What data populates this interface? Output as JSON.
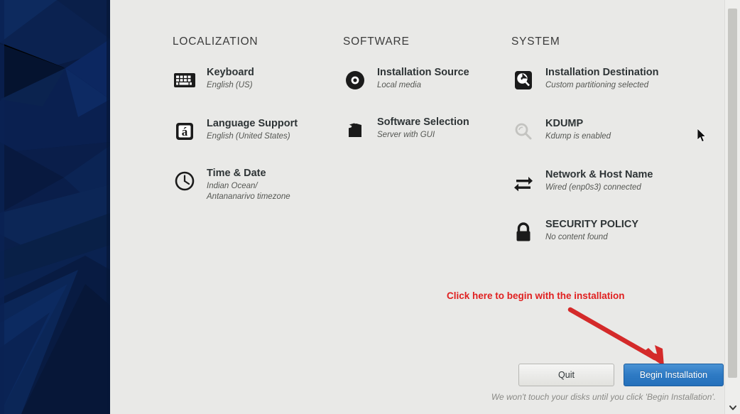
{
  "window": {
    "background_color": "#e9e9e7",
    "sidebar_color": "#0a1c44"
  },
  "columns": [
    {
      "id": "localization",
      "heading": "LOCALIZATION",
      "items": [
        {
          "icon": "keyboard-icon",
          "title": "Keyboard",
          "subtitle": "English (US)",
          "disabled": false
        },
        {
          "icon": "language-support-icon",
          "title": "Language Support",
          "subtitle": "English (United States)",
          "disabled": false
        },
        {
          "icon": "clock-icon",
          "title": "Time & Date",
          "subtitle": "Indian Ocean/\nAntananarivo timezone",
          "disabled": false
        }
      ]
    },
    {
      "id": "software",
      "heading": "SOFTWARE",
      "items": [
        {
          "icon": "disc-icon",
          "title": "Installation Source",
          "subtitle": "Local media",
          "disabled": false
        },
        {
          "icon": "package-icon",
          "title": "Software Selection",
          "subtitle": "Server with GUI",
          "disabled": false
        }
      ]
    },
    {
      "id": "system",
      "heading": "SYSTEM",
      "items": [
        {
          "icon": "hard-drive-icon",
          "title": "Installation Destination",
          "subtitle": "Custom partitioning selected",
          "disabled": false
        },
        {
          "icon": "magnifier-icon",
          "title": "KDUMP",
          "subtitle": "Kdump is enabled",
          "disabled": true
        },
        {
          "icon": "network-icon",
          "title": "Network & Host Name",
          "subtitle": "Wired (enp0s3) connected",
          "disabled": false
        },
        {
          "icon": "lock-icon",
          "title": "SECURITY POLICY",
          "subtitle": "No content found",
          "disabled": false
        }
      ]
    }
  ],
  "annotation": {
    "text": "Click here to begin with the installation",
    "color": "#e02020",
    "arrow_name": "red-pointer-arrow"
  },
  "footer": {
    "quit_label": "Quit",
    "begin_label": "Begin Installation",
    "note": "We won't touch your disks until you click 'Begin Installation'.",
    "begin_color": "#2e7ac4"
  },
  "scrollbar": {
    "down_arrow_icon": "chevron-down-icon"
  },
  "cursor": {
    "icon": "mouse-pointer-icon"
  }
}
